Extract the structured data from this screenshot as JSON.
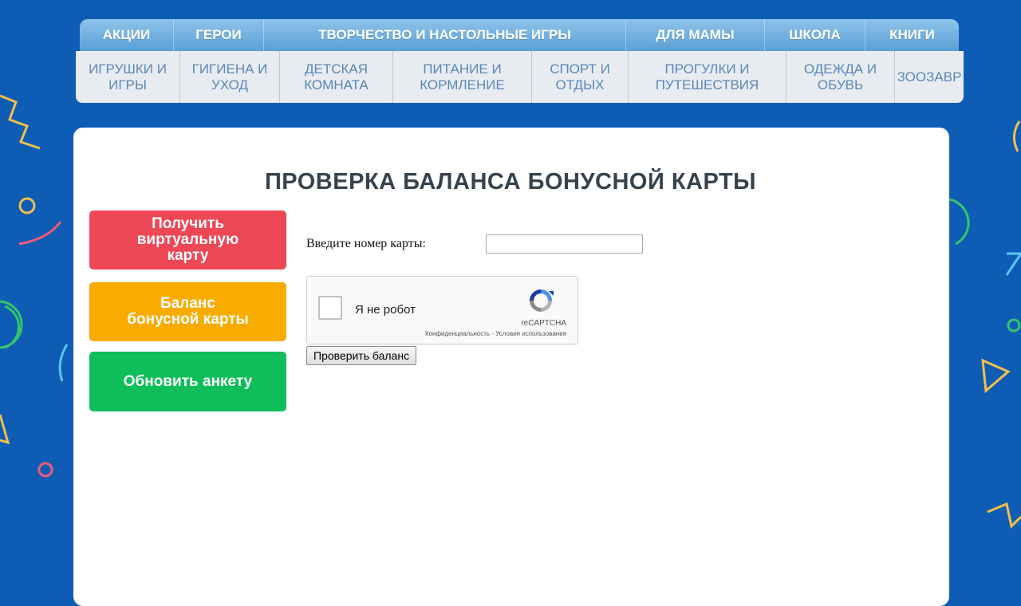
{
  "colors": {
    "page_bg": "#0f5cb5",
    "nav_top": "#6aaee0",
    "nav_sub_bg": "#e8ecf1",
    "nav_sub_text": "#5a86b8",
    "btn_virtual": "#ee4756",
    "btn_balance": "#f9ab00",
    "btn_update": "#0fbd59"
  },
  "nav_top": [
    {
      "label": "АКЦИИ"
    },
    {
      "label": "ГЕРОИ"
    },
    {
      "label": "ТВОРЧЕСТВО И НАСТОЛЬНЫЕ ИГРЫ"
    },
    {
      "label": "ДЛЯ МАМЫ"
    },
    {
      "label": "ШКОЛА"
    },
    {
      "label": "КНИГИ"
    }
  ],
  "nav_sub": [
    {
      "label": "ИГРУШКИ И\nИГРЫ"
    },
    {
      "label": "ГИГИЕНА И\nУХОД"
    },
    {
      "label": "ДЕТСКАЯ\nКОМНАТА"
    },
    {
      "label": "ПИТАНИЕ И\nКОРМЛЕНИЕ"
    },
    {
      "label": "СПОРТ И\nОТДЫХ"
    },
    {
      "label": "ПРОГУЛКИ И\nПУТЕШЕСТВИЯ"
    },
    {
      "label": "ОДЕЖДА И\nОБУВЬ"
    },
    {
      "label": "ЗООЗАВР"
    }
  ],
  "page": {
    "title": "ПРОВЕРКА БАЛАНСА БОНУСНОЙ КАРТЫ"
  },
  "sidebar": {
    "virtual_card": "Получить\nвиртуальную\nкарту",
    "bonus_balance": "Баланс\nбонусной карты",
    "update_profile": "Обновить анкету"
  },
  "form": {
    "card_label": "Введите номер карты:",
    "card_value": "",
    "submit_label": "Проверить баланс"
  },
  "recaptcha": {
    "label": "Я не робот",
    "brand": "reCAPTCHA",
    "links": "Конфиденциальность - Условия использования"
  }
}
